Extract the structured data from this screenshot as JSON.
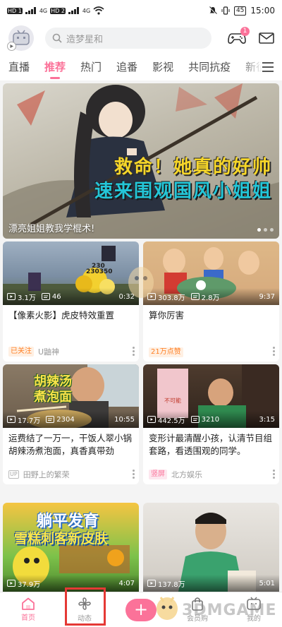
{
  "status_bar": {
    "sim1": "HD 1",
    "sim2": "HD 2",
    "net1": "4G",
    "net2": "4G",
    "battery": "45",
    "time": "15:00"
  },
  "header": {
    "search_placeholder": "造梦星和",
    "game_badge": "1"
  },
  "tabs": [
    "直播",
    "推荐",
    "热门",
    "追番",
    "影视",
    "共同抗疫",
    "新征"
  ],
  "banner": {
    "headline_1": "救命！她真的好帅",
    "headline_2": "速来围观国风小姐姐",
    "caption": "漂亮姐姐教我学棍术!"
  },
  "cards": [
    {
      "views": "3.1万",
      "danmaku": "46",
      "duration": "0:32",
      "title": "【像素火影】虎皮特效重置",
      "tag": "已关注",
      "author": "U鼬神",
      "up_label": "",
      "overlay_1": "230",
      "overlay_2": "230350"
    },
    {
      "views": "303.8万",
      "danmaku": "2.8万",
      "duration": "9:37",
      "title": "算你厉害",
      "tag": "21万点赞",
      "author": "",
      "up_label": ""
    },
    {
      "views": "17.7万",
      "danmaku": "2304",
      "duration": "10:55",
      "title": "运费结了一万一，干饭人翠小锅胡辣汤煮泡面，真香真带劲",
      "tag": "",
      "author": "田野上的繁荣",
      "up_label": "UP",
      "overlay_1": "胡辣汤",
      "overlay_2": "煮泡面"
    },
    {
      "views": "442.5万",
      "danmaku": "3210",
      "duration": "3:15",
      "title": "变形计最清醒小孩，认清节目组套路，看透围观的同学。",
      "tag": "竖屏",
      "author": "北方娱乐",
      "up_label": "",
      "overlay_1": "不可能"
    },
    {
      "views": "37.9万",
      "danmaku": "",
      "duration": "4:07",
      "title": "",
      "tag": "",
      "author": "",
      "up_label": "",
      "overlay_1": "躺平发育",
      "overlay_2": "雪糕刺客新皮肤"
    },
    {
      "views": "137.8万",
      "danmaku": "",
      "duration": "5:01",
      "title": "",
      "tag": "",
      "author": "",
      "up_label": ""
    }
  ],
  "bottom_nav": {
    "home": "首页",
    "dynamic": "动态",
    "mall": "会员购",
    "mine": "我的"
  },
  "watermark": "3DMGAME",
  "colors": {
    "accent": "#fb7299",
    "highlight": "#e53935",
    "banner_yellow": "#f6d629",
    "banner_cyan": "#24c6d8"
  }
}
